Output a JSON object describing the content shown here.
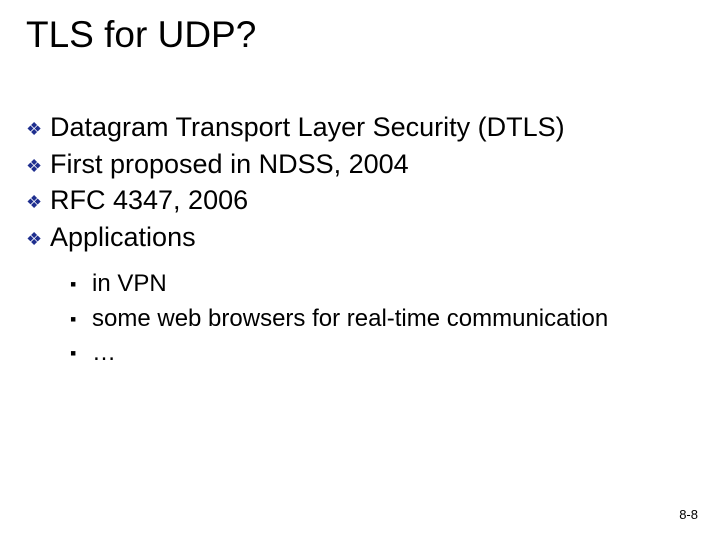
{
  "title": "TLS for UDP?",
  "bullets": {
    "b1": "Datagram Transport Layer Security (DTLS)",
    "b2": "First proposed in NDSS, 2004",
    "b3": "RFC 4347, 2006",
    "b4": "Applications"
  },
  "sub": {
    "s1": "in VPN",
    "s2": "some web browsers for real-time communication",
    "s3": "…"
  },
  "glyphs": {
    "diamond": "❖",
    "square": "▪"
  },
  "page": "8-8"
}
